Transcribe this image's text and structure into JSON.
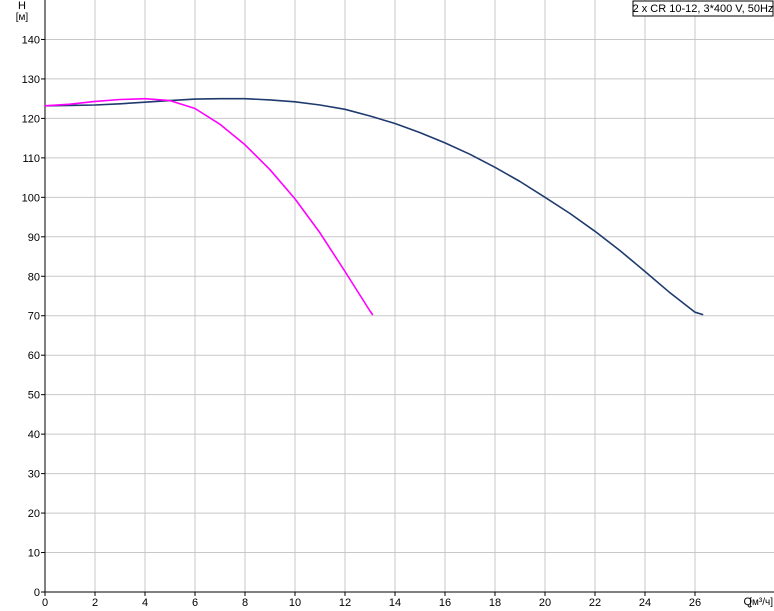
{
  "chart_data": {
    "type": "line",
    "title": "",
    "legend_box": "2 x CR 10-12, 3*400 V, 50Hz",
    "xlabel": "Q",
    "xunit": "[м³/ч]",
    "ylabel": "H",
    "yunit": "[м]",
    "xlim": [
      0,
      29
    ],
    "ylim": [
      0,
      150
    ],
    "xticks": [
      0,
      2,
      4,
      6,
      8,
      10,
      12,
      14,
      16,
      18,
      20,
      22,
      24,
      26
    ],
    "yticks": [
      0,
      10,
      20,
      30,
      40,
      50,
      60,
      70,
      80,
      90,
      100,
      110,
      120,
      130,
      140
    ],
    "grid": true,
    "series": [
      {
        "color": "#1f3a6e",
        "x": [
          0,
          1,
          2,
          3,
          4,
          5,
          6,
          7,
          8,
          9,
          10,
          11,
          12,
          13,
          14,
          15,
          16,
          17,
          18,
          19,
          20,
          21,
          22,
          23,
          24,
          25,
          26,
          26.3
        ],
        "y": [
          123.2,
          123.3,
          123.4,
          123.7,
          124.1,
          124.5,
          124.9,
          125.0,
          125.0,
          124.7,
          124.2,
          123.4,
          122.3,
          120.6,
          118.7,
          116.4,
          113.8,
          110.9,
          107.6,
          104.0,
          100.0,
          95.9,
          91.4,
          86.5,
          81.2,
          75.8,
          70.9,
          70.3
        ]
      },
      {
        "color": "#ff00ff",
        "x": [
          0,
          1,
          2,
          3,
          4,
          5,
          6,
          7,
          8,
          9,
          10,
          11,
          12,
          13,
          13.1
        ],
        "y": [
          123.2,
          123.6,
          124.3,
          124.8,
          125.0,
          124.5,
          122.5,
          118.5,
          113.3,
          107.0,
          99.6,
          91.0,
          81.2,
          71.2,
          70.3
        ]
      }
    ]
  }
}
